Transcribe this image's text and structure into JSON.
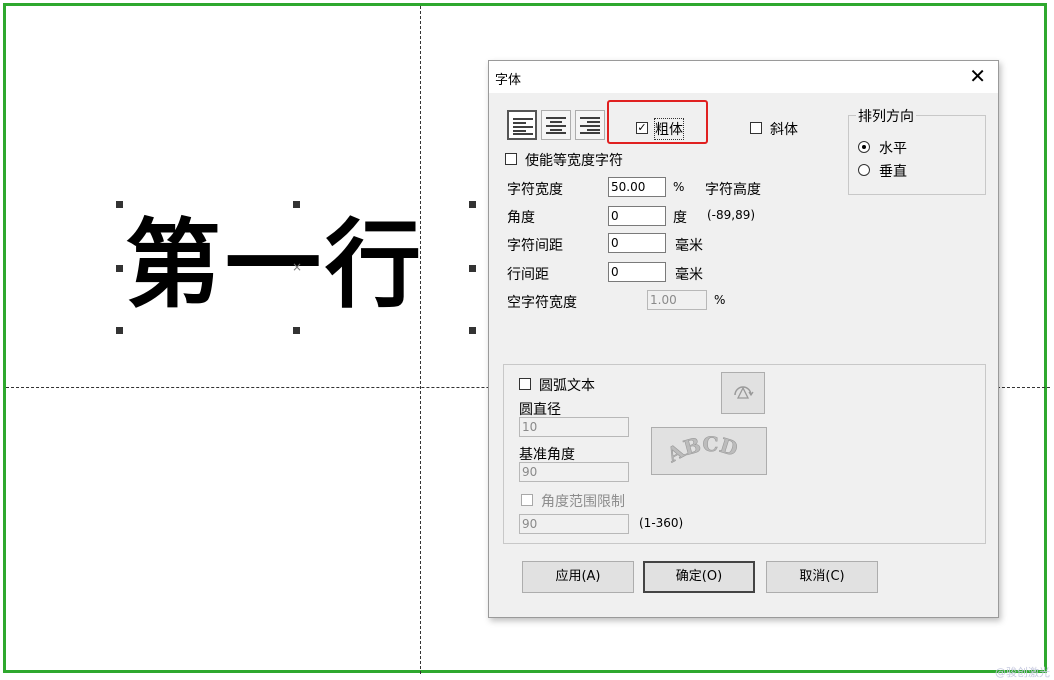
{
  "canvas": {
    "text": "第一行",
    "watermark": "@骏创激光"
  },
  "dialog": {
    "title": "字体",
    "close_glyph": "✕",
    "bold_label": "粗体",
    "italic_label": "斜体",
    "fixed_width_label": "使能等宽度字符",
    "char_width_label": "字符宽度",
    "char_width_value": "50.00",
    "char_width_unit": "%",
    "char_height_label": "字符高度",
    "angle_label": "角度",
    "angle_value": "0",
    "angle_unit": "度",
    "angle_range": "(-89,89)",
    "char_spacing_label": "字符间距",
    "char_spacing_value": "0",
    "char_spacing_unit": "毫米",
    "line_spacing_label": "行间距",
    "line_spacing_value": "0",
    "line_spacing_unit": "毫米",
    "space_width_label": "空字符宽度",
    "space_width_value": "1.00",
    "space_width_unit": "%",
    "direction_group": "排列方向",
    "horizontal_label": "水平",
    "vertical_label": "垂直",
    "arc_text_label": "圆弧文本",
    "diameter_label": "圆直径",
    "diameter_value": "10",
    "base_angle_label": "基准角度",
    "base_angle_value": "90",
    "angle_limit_label": "角度范围限制",
    "angle_limit_value": "90",
    "angle_limit_range": "(1-360)",
    "arc_preview_text": "ABCD",
    "apply_button": "应用(A)",
    "ok_button": "确定(O)",
    "cancel_button": "取消(C)"
  },
  "icons": {
    "checkmark": "✓",
    "arc_rotate": "arc-rotate-icon"
  },
  "colors": {
    "frame_border": "#2ea82e",
    "highlight": "#e02020",
    "dialog_bg": "#f0f0f0"
  }
}
